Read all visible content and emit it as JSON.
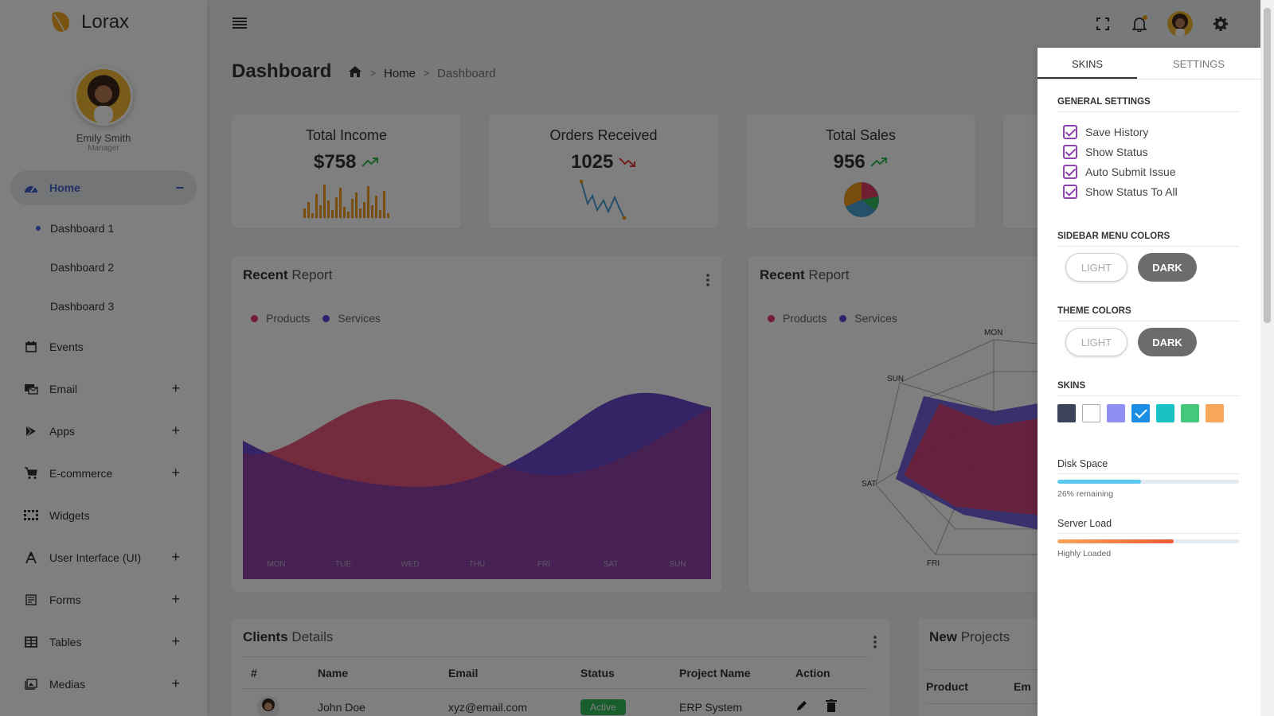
{
  "brand": {
    "name": "Lorax"
  },
  "user": {
    "name": "Emily Smith",
    "role": "Manager"
  },
  "sidebar": {
    "items": [
      {
        "label": "Home",
        "icon": "dashboard-icon",
        "toggle": "−"
      },
      {
        "label": "Events",
        "icon": "calendar-icon"
      },
      {
        "label": "Email",
        "icon": "email-icon",
        "toggle": "+"
      },
      {
        "label": "Apps",
        "icon": "apps-icon",
        "toggle": "+"
      },
      {
        "label": "E-commerce",
        "icon": "cart-icon",
        "toggle": "+"
      },
      {
        "label": "Widgets",
        "icon": "widgets-icon"
      },
      {
        "label": "User Interface (UI)",
        "icon": "ui-icon",
        "toggle": "+"
      },
      {
        "label": "Forms",
        "icon": "forms-icon",
        "toggle": "+"
      },
      {
        "label": "Tables",
        "icon": "table-icon",
        "toggle": "+"
      },
      {
        "label": "Medias",
        "icon": "media-icon",
        "toggle": "+"
      }
    ],
    "subitems": [
      "Dashboard 1",
      "Dashboard 2",
      "Dashboard 3"
    ]
  },
  "header": {
    "title": "Dashboard",
    "breadcrumb": [
      "Home",
      "Dashboard"
    ]
  },
  "stats": [
    {
      "title": "Total Income",
      "value": "$758",
      "trend": "up"
    },
    {
      "title": "Orders Received",
      "value": "1025",
      "trend": "down"
    },
    {
      "title": "Total Sales",
      "value": "956",
      "trend": "up"
    }
  ],
  "report1": {
    "title_bold": "Recent",
    "title_rest": " Report",
    "legend": [
      "Products",
      "Services"
    ],
    "days": [
      "MON",
      "TUE",
      "WED",
      "THU",
      "FRI",
      "SAT",
      "SUN"
    ]
  },
  "report2": {
    "title_bold": "Recent",
    "title_rest": " Report",
    "legend": [
      "Products",
      "Services"
    ],
    "radar_labels": [
      "MON",
      "SUN",
      "SAT",
      "FRI"
    ]
  },
  "clients": {
    "title_bold": "Clients",
    "title_rest": " Details",
    "columns": [
      "#",
      "Name",
      "Email",
      "Status",
      "Project Name",
      "Action"
    ],
    "rows": [
      {
        "name": "John Doe",
        "email": "xyz@email.com",
        "status": "Active",
        "project": "ERP System"
      }
    ]
  },
  "projects": {
    "title_bold": "New",
    "title_rest": " Projects",
    "columns": [
      "Product",
      "Em"
    ]
  },
  "panel": {
    "tabs": [
      "SKINS",
      "SETTINGS"
    ],
    "general_title": "GENERAL SETTINGS",
    "checks": [
      "Save History",
      "Show Status",
      "Auto Submit Issue",
      "Show Status To All"
    ],
    "sidebar_colors_title": "SIDEBAR MENU COLORS",
    "theme_colors_title": "THEME COLORS",
    "light_label": "LIGHT",
    "dark_label": "DARK",
    "skins_title": "SKINS",
    "skins": [
      "#3c4257",
      "#ffffff",
      "#8e8ff0",
      "#1a8fe3",
      "#19c3c3",
      "#44c87a",
      "#f7a65a"
    ],
    "disk_title": "Disk Space",
    "disk_note": "26% remaining",
    "disk_fraction": 0.46,
    "server_title": "Server Load",
    "server_note": "Highly Loaded",
    "server_fraction": 0.64
  },
  "colors": {
    "accent": "#3f62c8",
    "products": "#e23c64",
    "services": "#5b47d6",
    "income_bars": "#f09a1b",
    "orders_line": "#4aa0d5",
    "active_badge": "#2ebd59"
  }
}
